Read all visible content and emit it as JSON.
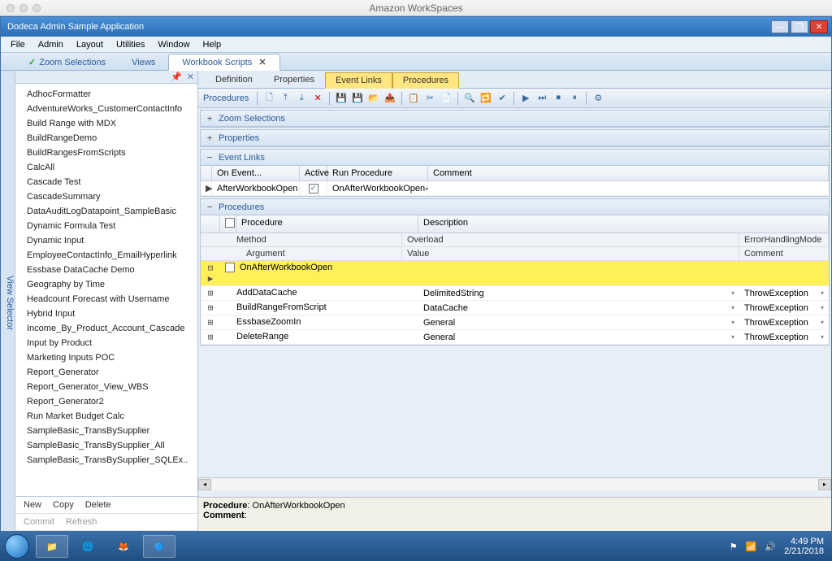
{
  "mac_title": "Amazon WorkSpaces",
  "app_title": "Dodeca Admin Sample Application",
  "menubar": [
    "File",
    "Admin",
    "Layout",
    "Utilities",
    "Window",
    "Help"
  ],
  "side_tab": "View Selector",
  "doc_tabs": [
    {
      "label": "Zoom Selections",
      "active": false,
      "check": true
    },
    {
      "label": "Views",
      "active": false
    },
    {
      "label": "Workbook Scripts",
      "active": true,
      "closable": true
    }
  ],
  "tree": [
    "AdhocFormatter",
    "AdventureWorks_CustomerContactInfo",
    "Build Range with MDX",
    "BuildRangeDemo",
    "BuildRangesFromScripts",
    "CalcAll",
    "Cascade Test",
    "CascadeSummary",
    "DataAuditLogDatapoint_SampleBasic",
    "Dynamic Formula Test",
    "Dynamic Input",
    "EmployeeContactInfo_EmailHyperlink",
    "Essbase DataCache Demo",
    "Geography by Time",
    "Headcount Forecast with Username",
    "Hybrid Input",
    "Income_By_Product_Account_Cascade",
    "Input by Product",
    "Marketing Inputs POC",
    "Report_Generator",
    "Report_Generator_View_WBS",
    "Report_Generator2",
    "Run Market Budget Calc",
    "SampleBasic_TransBySupplier",
    "SampleBasic_TransBySupplier_All",
    "SampleBasic_TransBySupplier_SQLEx.."
  ],
  "left_actions": {
    "new": "New",
    "copy": "Copy",
    "delete": "Delete",
    "commit": "Commit",
    "refresh": "Refresh"
  },
  "sub_tabs": [
    "Definition",
    "Properties",
    "Event Links",
    "Procedures"
  ],
  "sub_tabs_hl": [
    2,
    3
  ],
  "toolbar_label": "Procedures",
  "sections": {
    "zoom": "Zoom Selections",
    "props": "Properties",
    "events": "Event Links",
    "procs": "Procedures"
  },
  "event_cols": {
    "on": "On Event...",
    "active": "Active",
    "run": "Run Procedure",
    "comment": "Comment"
  },
  "event_row": {
    "on": "AfterWorkbookOpen",
    "active": true,
    "run": "OnAfterWorkbookOpen",
    "comment": ""
  },
  "proc_cols": {
    "proc": "Procedure",
    "desc": "Description"
  },
  "proc_sub1": {
    "method": "Method",
    "overload": "Overload",
    "err": "ErrorHandlingMode"
  },
  "proc_sub2": {
    "arg": "Argument",
    "val": "Value",
    "com": "Comment"
  },
  "selected_proc": "OnAfterWorkbookOpen",
  "proc_rows": [
    {
      "name": "AddDataCache",
      "ov": "DelimitedString",
      "err": "ThrowException"
    },
    {
      "name": "BuildRangeFromScript",
      "ov": "DataCache",
      "err": "ThrowException"
    },
    {
      "name": "EssbaseZoomIn",
      "ov": "General",
      "err": "ThrowException"
    },
    {
      "name": "DeleteRange",
      "ov": "General",
      "err": "ThrowException"
    }
  ],
  "info": {
    "proc_lbl": "Procedure",
    "proc_val": ": OnAfterWorkbookOpen",
    "com_lbl": "Comment",
    "com_val": ":"
  },
  "tray": {
    "time": "4:49 PM",
    "date": "2/21/2018"
  }
}
